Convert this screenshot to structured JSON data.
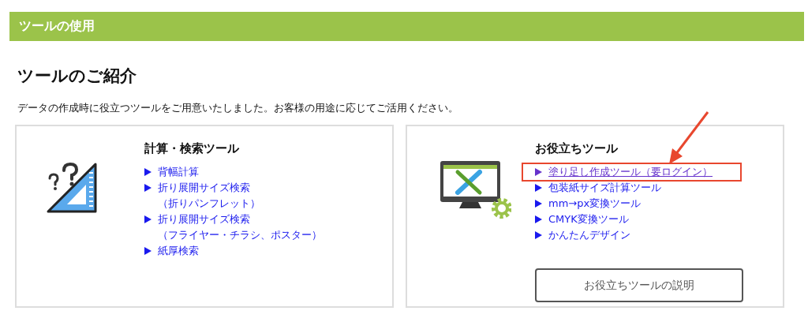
{
  "section_bar": {
    "title": "ツールの使用"
  },
  "heading": "ツールのご紹介",
  "description": "データの作成時に役立つツールをご用意いたしました。お客様の用途に応じてご活用ください。",
  "cards": [
    {
      "kind": "calc",
      "title": "計算・検索ツール",
      "links": [
        {
          "lines": [
            "背幅計算"
          ],
          "visited": false,
          "highlighted": false
        },
        {
          "lines": [
            "折り展開サイズ検索",
            "（折りパンフレット）"
          ],
          "visited": false,
          "highlighted": false
        },
        {
          "lines": [
            "折り展開サイズ検索",
            "（フライヤー・チラシ、ポスター）"
          ],
          "visited": false,
          "highlighted": false
        },
        {
          "lines": [
            "紙厚検索"
          ],
          "visited": false,
          "highlighted": false
        }
      ]
    },
    {
      "kind": "tools",
      "title": "お役立ちツール",
      "links": [
        {
          "lines": [
            "塗り足し作成ツール（要ログイン）"
          ],
          "visited": true,
          "highlighted": true
        },
        {
          "lines": [
            "包装紙サイズ計算ツール"
          ],
          "visited": false,
          "highlighted": false
        },
        {
          "lines": [
            "mm→px変換ツール"
          ],
          "visited": false,
          "highlighted": false
        },
        {
          "lines": [
            "CMYK変換ツール"
          ],
          "visited": false,
          "highlighted": false
        },
        {
          "lines": [
            "かんたんデザイン"
          ],
          "visited": false,
          "highlighted": false
        }
      ],
      "button": "お役立ちツールの説明"
    }
  ]
}
